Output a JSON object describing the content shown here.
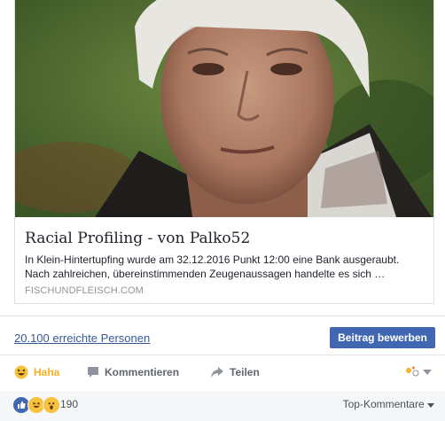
{
  "link_card": {
    "title": "Racial Profiling - von Palko52",
    "description": "In Klein-Hintertupfing wurde am 32.12.2016 Punkt 12:00 eine Bank ausgeraubt. Nach zahlreichen, übereinstimmenden Zeugenaussagen handelte es sich …",
    "domain": "FISCHUNDFLEISCH.COM"
  },
  "insights": {
    "reach_text": "20.100 erreichte Personen",
    "boost_label": "Beitrag bewerben"
  },
  "actions": {
    "haha_label": "Haha",
    "comment_label": "Kommentieren",
    "share_label": "Teilen"
  },
  "reactions": {
    "count": "190",
    "sort_label": "Top-Kommentare"
  },
  "colors": {
    "link": "#365899",
    "button": "#4267b2",
    "haha": "#f7b125"
  }
}
